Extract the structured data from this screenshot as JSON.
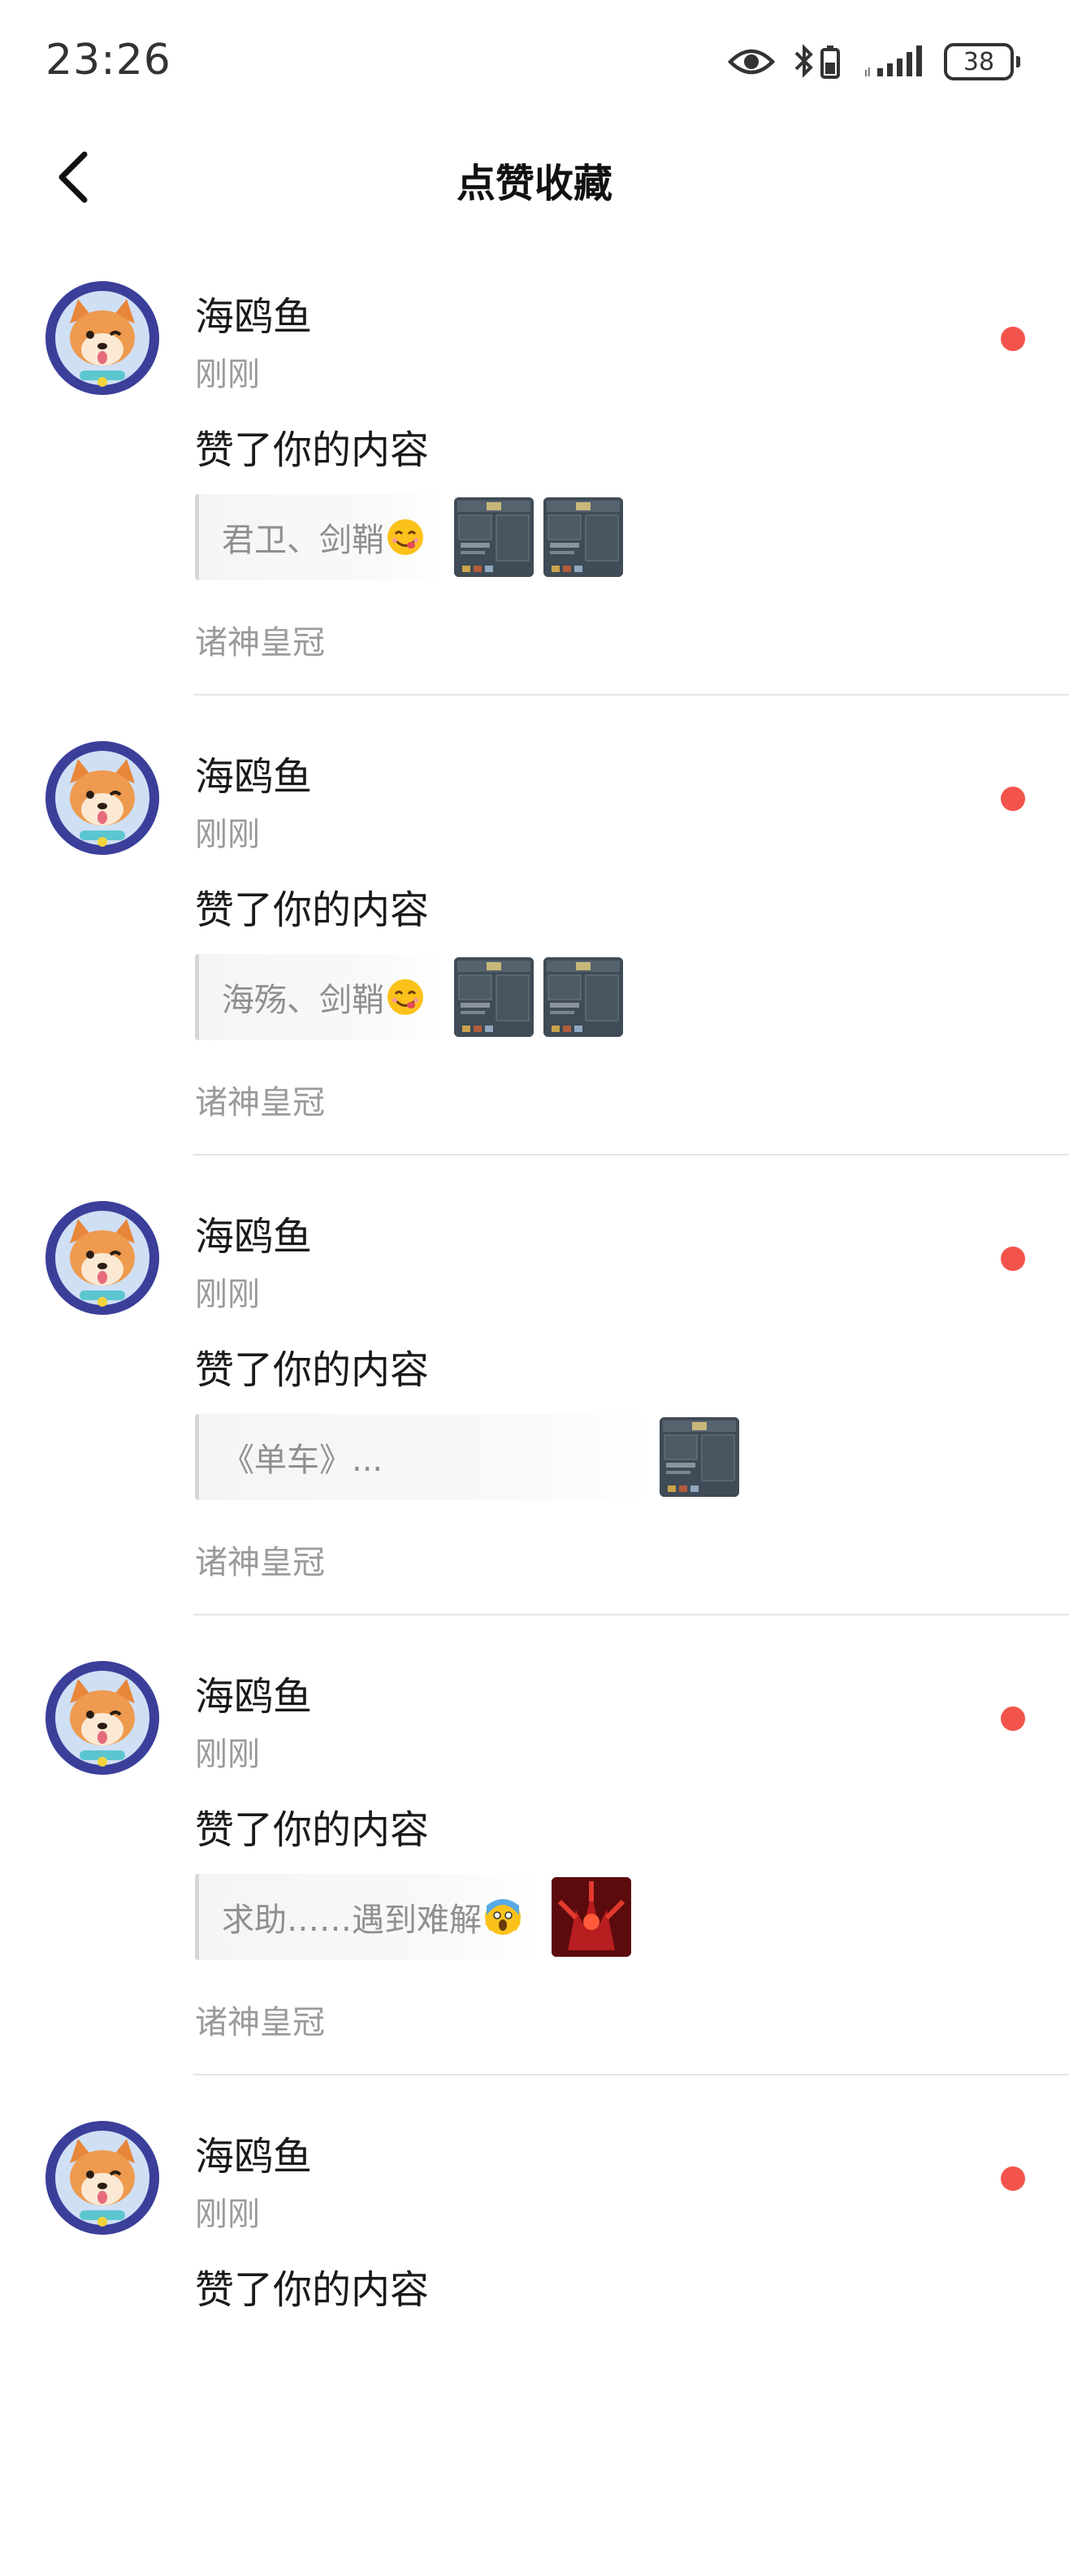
{
  "status": {
    "time": "23:26",
    "battery": "38",
    "icons": [
      "eye-icon",
      "bluetooth-icon",
      "battery-saver-icon",
      "signal-icon",
      "battery-icon"
    ]
  },
  "nav": {
    "title": "点赞收藏",
    "back_icon": "chevron-left-icon"
  },
  "items": [
    {
      "user": "海鸥鱼",
      "time": "刚刚",
      "action": "赞了你的内容",
      "quote": "君卫、剑鞘",
      "emoji": "yum-emoji",
      "thumbs": [
        "game-screenshot",
        "game-screenshot"
      ],
      "circle": "诸神皇冠",
      "unread": true
    },
    {
      "user": "海鸥鱼",
      "time": "刚刚",
      "action": "赞了你的内容",
      "quote": "海殇、剑鞘",
      "emoji": "yum-emoji",
      "thumbs": [
        "game-screenshot",
        "game-screenshot"
      ],
      "circle": "诸神皇冠",
      "unread": true
    },
    {
      "user": "海鸥鱼",
      "time": "刚刚",
      "action": "赞了你的内容",
      "quote": "《单车》...",
      "emoji": "",
      "thumbs": [
        "game-screenshot"
      ],
      "circle": "诸神皇冠",
      "unread": true
    },
    {
      "user": "海鸥鱼",
      "time": "刚刚",
      "action": "赞了你的内容",
      "quote": "求助……遇到难解",
      "emoji": "scream-emoji",
      "thumbs": [
        "red-monster-image"
      ],
      "circle": "诸神皇冠",
      "unread": true
    },
    {
      "user": "海鸥鱼",
      "time": "刚刚",
      "action": "赞了你的内容",
      "quote": "",
      "emoji": "",
      "thumbs": [],
      "circle": "",
      "unread": true
    }
  ],
  "colors": {
    "unread_dot": "#f2544c",
    "avatar_ring": "#3b3f9a",
    "muted_text": "#9a9a9a"
  }
}
